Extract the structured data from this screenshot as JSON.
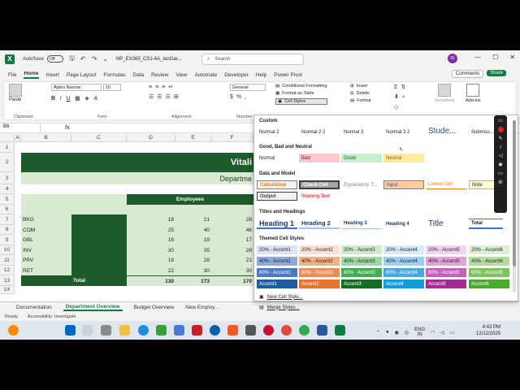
{
  "titlebar": {
    "autosave": "AutoSave",
    "autosave_state": "Off",
    "filename": "NP_EX365_CS1-4A_IanGar...",
    "search_placeholder": "Search",
    "avatar_initials": "IG"
  },
  "tabs": [
    "File",
    "Home",
    "Insert",
    "Page Layout",
    "Formulas",
    "Data",
    "Review",
    "View",
    "Automate",
    "Developer",
    "Help",
    "Power Pivot"
  ],
  "actions": {
    "comments": "Comments",
    "share": "Share"
  },
  "ribbon": {
    "paste": "Paste",
    "clipboard": "Clipboard",
    "font_name": "Aptos Narrow",
    "font_size": "10",
    "font_label": "Font",
    "alignment_label": "Alignment",
    "number_format": "General",
    "number_label": "Number",
    "conditional": "Conditional Formatting",
    "format_table": "Format as Table",
    "cell_styles": "Cell Styles",
    "insert": "Insert",
    "delete": "Delete",
    "format": "Format",
    "sensitivity": "Sensitivity",
    "addins": "Add-ins"
  },
  "formula_bar": {
    "namebox": "B6",
    "fx": "fx"
  },
  "columns": [
    "A",
    "B",
    "C",
    "D",
    "E",
    "F"
  ],
  "rows": [
    "1",
    "2",
    "3",
    "4",
    "5",
    "6",
    "7",
    "8",
    "9",
    "10",
    "11",
    "12",
    "13",
    "14"
  ],
  "sheet": {
    "title_fragment": "Vitali",
    "subtitle_fragment": "Departme",
    "employees_header": "Employees",
    "data": [
      {
        "dept": "BKO",
        "d": "18",
        "e": "21",
        "f": "28"
      },
      {
        "dept": "COM",
        "d": "25",
        "e": "40",
        "f": "46"
      },
      {
        "dept": "GBL",
        "d": "16",
        "e": "19",
        "f": "17"
      },
      {
        "dept": "INV",
        "d": "30",
        "e": "35",
        "f": "28"
      },
      {
        "dept": "PRV",
        "d": "19",
        "e": "28",
        "f": "21"
      },
      {
        "dept": "RET",
        "d": "22",
        "e": "30",
        "f": "30"
      }
    ],
    "total_label": "Total",
    "totals": {
      "d": "130",
      "e": "173",
      "f": "170"
    }
  },
  "sheet_tabs": [
    "Documentation",
    "Department Overview",
    "Budget Overview",
    "New Employ..."
  ],
  "status": {
    "ready": "Ready",
    "accessibility": "Accessibility: Investigate"
  },
  "taskbar": {
    "lang1": "ENG",
    "lang2": "IN",
    "time": "4:43 PM",
    "date": "12/12/2025"
  },
  "cell_styles": {
    "custom": "Custom",
    "custom_items": [
      "Normal 2",
      "Normal 2 2",
      "Normal 3",
      "Normal 3 2",
      "Stude...",
      "Submiss..."
    ],
    "gbn": "Good, Bad and Neutral",
    "gbn_items": [
      "Normal",
      "Bad",
      "Good",
      "Neutral"
    ],
    "dm": "Data and Model",
    "dm_items": [
      "Calculation",
      "Check Cell",
      "Explanatory T...",
      "Input",
      "Linked Cell",
      "Note"
    ],
    "dm_items2": [
      "Output",
      "Warning Text"
    ],
    "th": "Titles and Headings",
    "th_items": [
      "Heading 1",
      "Heading 2",
      "Heading 3",
      "Heading 4",
      "Title",
      "Total"
    ],
    "tcs": "Themed Cell Styles",
    "row20": [
      "20% - Accent1",
      "20% - Accent2",
      "20% - Accent3",
      "20% - Accent4",
      "20% - Accent5",
      "20% - Accent6"
    ],
    "row40": [
      "40% - Accent1",
      "40% - Accent2",
      "40% - Accent3",
      "40% - Accent4",
      "40% - Accent5",
      "40% - Accent6"
    ],
    "row60": [
      "60% - Accent1",
      "60% - Accent2",
      "60% - Accent3",
      "60% - Accent4",
      "60% - Accent5",
      "60% - Accent6"
    ],
    "rowacc": [
      "Accent1",
      "Accent2",
      "Accent3",
      "Accent4",
      "Accent5",
      "Accent6"
    ],
    "new_style": "New Cell Style...",
    "merge_styles": "Merge Styles..."
  },
  "colors": {
    "excel_green": "#107c41",
    "dark_green": "#1e5a2a",
    "light_green": "#d9ead3",
    "mid_green": "#b6d7a8"
  }
}
